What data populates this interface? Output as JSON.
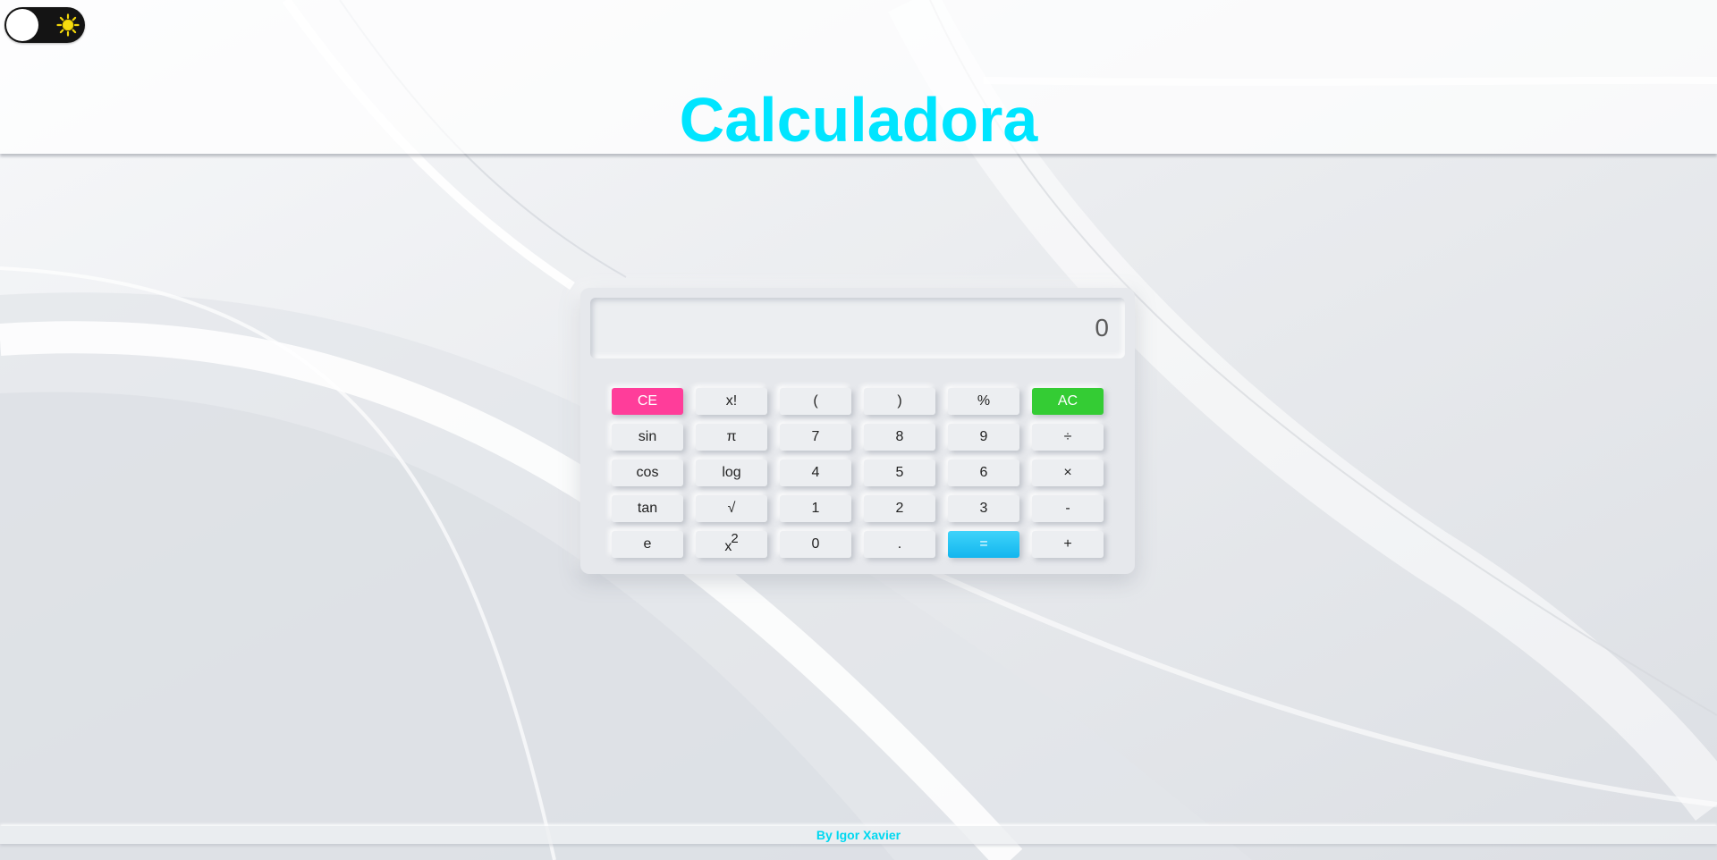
{
  "page": {
    "title": "Calculadora",
    "footer": "By Igor Xavier"
  },
  "theme_toggle": {
    "state": "light",
    "icon": "sun-icon"
  },
  "display": {
    "value": "0"
  },
  "keypad": {
    "rows": [
      [
        {
          "label": "CE",
          "name": "clear-entry-button",
          "style": "ce"
        },
        {
          "label": "x!",
          "name": "factorial-button"
        },
        {
          "label": "(",
          "name": "open-paren-button"
        },
        {
          "label": ")",
          "name": "close-paren-button"
        },
        {
          "label": "%",
          "name": "percent-button"
        },
        {
          "label": "AC",
          "name": "all-clear-button",
          "style": "ac"
        }
      ],
      [
        {
          "label": "sin",
          "name": "sin-button"
        },
        {
          "label": "π",
          "name": "pi-button"
        },
        {
          "label": "7",
          "name": "digit-7-button"
        },
        {
          "label": "8",
          "name": "digit-8-button"
        },
        {
          "label": "9",
          "name": "digit-9-button"
        },
        {
          "label": "÷",
          "name": "divide-button"
        }
      ],
      [
        {
          "label": "cos",
          "name": "cos-button"
        },
        {
          "label": "log",
          "name": "log-button"
        },
        {
          "label": "4",
          "name": "digit-4-button"
        },
        {
          "label": "5",
          "name": "digit-5-button"
        },
        {
          "label": "6",
          "name": "digit-6-button"
        },
        {
          "label": "×",
          "name": "multiply-button"
        }
      ],
      [
        {
          "label": "tan",
          "name": "tan-button"
        },
        {
          "label": "√",
          "name": "sqrt-button"
        },
        {
          "label": "1",
          "name": "digit-1-button"
        },
        {
          "label": "2",
          "name": "digit-2-button"
        },
        {
          "label": "3",
          "name": "digit-3-button"
        },
        {
          "label": "-",
          "name": "subtract-button"
        }
      ],
      [
        {
          "label": "e",
          "name": "euler-button"
        },
        {
          "label": "x",
          "sup": "2",
          "name": "square-button",
          "style": "square"
        },
        {
          "label": "0",
          "name": "digit-0-button"
        },
        {
          "label": ".",
          "name": "decimal-button"
        },
        {
          "label": "=",
          "name": "equals-button",
          "style": "equals"
        },
        {
          "label": "+",
          "name": "add-button"
        }
      ]
    ]
  },
  "colors": {
    "accent": "#00e5ff",
    "clear_entry": "#ff3d9a",
    "all_clear": "#34cc34",
    "equals": "#22c7f2",
    "background": "#eceef1"
  }
}
